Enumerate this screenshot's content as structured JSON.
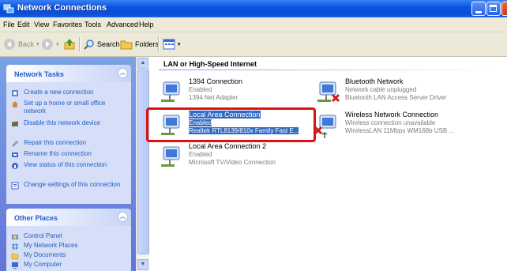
{
  "window": {
    "title": "Network Connections"
  },
  "menu": [
    {
      "label": "File"
    },
    {
      "label": "Edit"
    },
    {
      "label": "View"
    },
    {
      "label": "Favorites"
    },
    {
      "label": "Tools"
    },
    {
      "label": "Advanced"
    },
    {
      "label": "Help"
    }
  ],
  "toolbar": {
    "back": "Back",
    "search": "Search",
    "folders": "Folders"
  },
  "sidebar": {
    "network_tasks": {
      "title": "Network Tasks",
      "items": [
        {
          "label": "Create a new connection",
          "icon": "new-connection-icon"
        },
        {
          "label": "Set up a home or small office network",
          "icon": "home-network-icon"
        },
        {
          "label": "Disable this network device",
          "icon": "disable-device-icon"
        },
        {
          "label": "Repair this connection",
          "icon": "repair-icon"
        },
        {
          "label": "Rename this connection",
          "icon": "rename-icon"
        },
        {
          "label": "View status of this connection",
          "icon": "status-icon"
        },
        {
          "label": "Change settings of this connection",
          "icon": "settings-icon"
        }
      ]
    },
    "other_places": {
      "title": "Other Places",
      "items": [
        {
          "label": "Control Panel",
          "icon": "control-panel-icon"
        },
        {
          "label": "My Network Places",
          "icon": "network-places-icon"
        },
        {
          "label": "My Documents",
          "icon": "documents-icon"
        },
        {
          "label": "My Computer",
          "icon": "computer-icon"
        }
      ]
    }
  },
  "content": {
    "group_title": "LAN or High-Speed Internet",
    "connections": [
      {
        "name": "1394 Connection",
        "status": "Enabled",
        "device": "1394 Net Adapter",
        "selected": false,
        "disconnected": false
      },
      {
        "name": "Bluetooth Network",
        "status": "Network cable unplugged",
        "device": "Bluetooth LAN Access Server Driver",
        "selected": false,
        "disconnected": true
      },
      {
        "name": "Local Area Connection",
        "status": "Enabled",
        "device": "Realtek RTL8139/810x Family Fast E...",
        "selected": true,
        "disconnected": false
      },
      {
        "name": "Wireless Network Connection",
        "status": "Wireless connection unavailable",
        "device": "WirelessLAN 11Mbps WM168b USB ...",
        "selected": false,
        "disconnected": true
      },
      {
        "name": "Local Area Connection 2",
        "status": "Enabled",
        "device": "Microsoft TV/Video Connection",
        "selected": false,
        "disconnected": false
      }
    ]
  },
  "colors": {
    "title_bar": "#0a55e0",
    "highlight": "#e01010",
    "selection": "#316ac5",
    "task_link": "#215dc6"
  }
}
